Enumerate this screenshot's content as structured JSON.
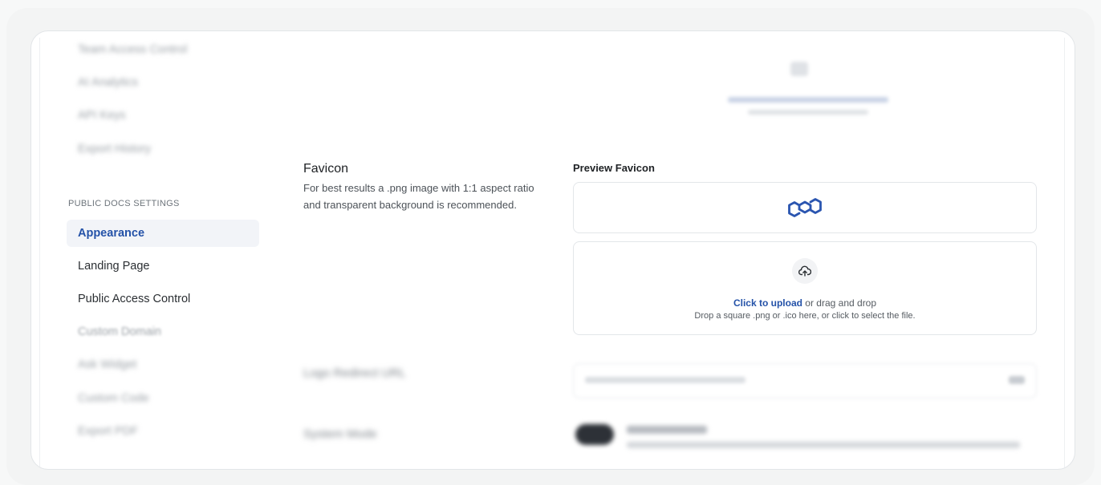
{
  "sidebar": {
    "blurred_items_top": [
      "Team Access Control",
      "AI Analytics",
      "API Keys",
      "Export History"
    ],
    "section_label": "PUBLIC DOCS SETTINGS",
    "items": [
      {
        "label": "Appearance",
        "active": true
      },
      {
        "label": "Landing Page",
        "active": false
      },
      {
        "label": "Public Access Control",
        "active": false
      },
      {
        "label": "Custom Domain",
        "active": false
      }
    ],
    "blurred_items_bottom": [
      "Ask Widget",
      "Custom Code",
      "Export PDF"
    ]
  },
  "favicon_setting": {
    "title": "Favicon",
    "description": "For best results a .png image with 1:1 aspect ratio and transparent background is recommended.",
    "preview_label": "Preview Favicon",
    "upload": {
      "link_text": "Click to upload",
      "rest_text": " or drag and drop",
      "hint": "Drop a square .png or .ico here, or click to select the file."
    }
  },
  "blurred_rows": {
    "logo_redirect_label": "Logo Redirect URL",
    "system_mode_label": "System Mode"
  },
  "colors": {
    "accent": "#2452a8",
    "active_bg": "#f2f4f8",
    "border": "#e3e6e9"
  },
  "icons": {
    "favicon": "hexagon-link-icon",
    "upload": "cloud-upload-icon"
  }
}
